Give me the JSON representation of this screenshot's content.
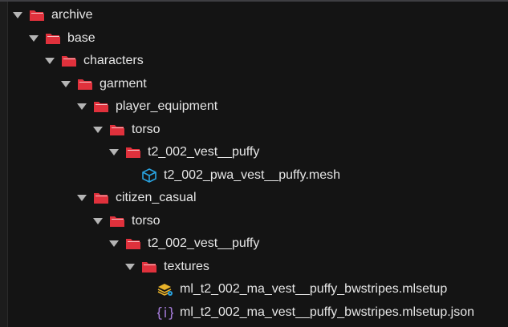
{
  "tree": [
    {
      "label": "archive",
      "level": 0,
      "type": "folder",
      "expanded": true
    },
    {
      "label": "base",
      "level": 1,
      "type": "folder",
      "expanded": true
    },
    {
      "label": "characters",
      "level": 2,
      "type": "folder",
      "expanded": true
    },
    {
      "label": "garment",
      "level": 3,
      "type": "folder",
      "expanded": true
    },
    {
      "label": "player_equipment",
      "level": 4,
      "type": "folder",
      "expanded": true
    },
    {
      "label": "torso",
      "level": 5,
      "type": "folder",
      "expanded": true
    },
    {
      "label": "t2_002_vest__puffy",
      "level": 6,
      "type": "folder",
      "expanded": true
    },
    {
      "label": "t2_002_pwa_vest__puffy.mesh",
      "level": 7,
      "type": "mesh"
    },
    {
      "label": "citizen_casual",
      "level": 4,
      "type": "folder",
      "expanded": true
    },
    {
      "label": "torso",
      "level": 5,
      "type": "folder",
      "expanded": true
    },
    {
      "label": "t2_002_vest__puffy",
      "level": 6,
      "type": "folder",
      "expanded": true
    },
    {
      "label": "textures",
      "level": 7,
      "type": "folder",
      "expanded": true
    },
    {
      "label": "ml_t2_002_ma_vest__puffy_bwstripes.mlsetup",
      "level": 8,
      "type": "mlsetup"
    },
    {
      "label": "ml_t2_002_ma_vest__puffy_bwstripes.mlsetup.json",
      "level": 8,
      "type": "json"
    }
  ],
  "colors": {
    "folder": "#e0313c",
    "mesh": "#29a3e0",
    "mlsetup": "#e8b22a",
    "json": "#a37ad6"
  }
}
